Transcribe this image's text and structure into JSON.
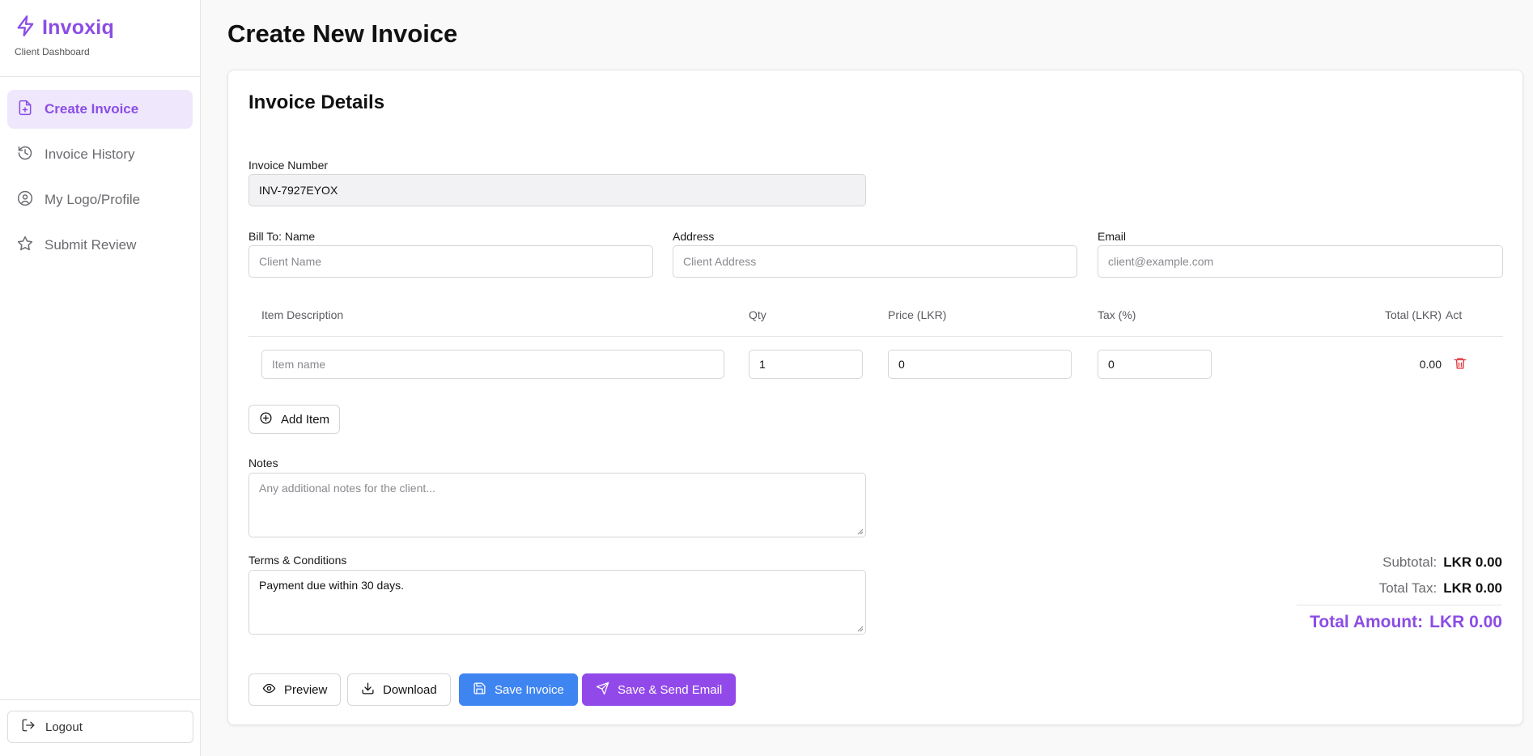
{
  "sidebar": {
    "brand": "Invoxiq",
    "subtitle": "Client Dashboard",
    "items": [
      {
        "label": "Create Invoice",
        "icon": "file-plus-icon",
        "active": true
      },
      {
        "label": "Invoice History",
        "icon": "history-icon"
      },
      {
        "label": "My Logo/Profile",
        "icon": "user-circle-icon"
      },
      {
        "label": "Submit Review",
        "icon": "star-icon"
      }
    ],
    "logout": "Logout"
  },
  "page": {
    "title": "Create New Invoice",
    "card_title": "Invoice Details"
  },
  "form": {
    "invoice_number_label": "Invoice Number",
    "invoice_number_value": "INV-7927EYOX",
    "bill_to_label": "Bill To: Name",
    "bill_to_placeholder": "Client Name",
    "address_label": "Address",
    "address_placeholder": "Client Address",
    "email_label": "Email",
    "email_placeholder": "client@example.com"
  },
  "items_table": {
    "headers": {
      "description": "Item Description",
      "qty": "Qty",
      "price": "Price (LKR)",
      "tax": "Tax (%)",
      "total": "Total (LKR)",
      "act": "Act"
    },
    "rows": [
      {
        "description_placeholder": "Item name",
        "qty": "1",
        "price": "0",
        "tax": "0",
        "total": "0.00"
      }
    ],
    "add_item": "Add Item"
  },
  "notes": {
    "label": "Notes",
    "placeholder": "Any additional notes for the client..."
  },
  "terms": {
    "label": "Terms & Conditions",
    "value": "Payment due within 30 days."
  },
  "summary": {
    "subtotal_label": "Subtotal:",
    "subtotal_value": "LKR 0.00",
    "tax_label": "Total Tax:",
    "tax_value": "LKR 0.00",
    "total_label": "Total Amount:",
    "total_value": "LKR 0.00"
  },
  "actions": {
    "preview": "Preview",
    "download": "Download",
    "save": "Save Invoice",
    "send": "Save & Send Email"
  },
  "colors": {
    "accent": "#8b4de6",
    "blue": "#3f85f1",
    "purple_button": "#9249ea",
    "danger": "#e0363b"
  }
}
